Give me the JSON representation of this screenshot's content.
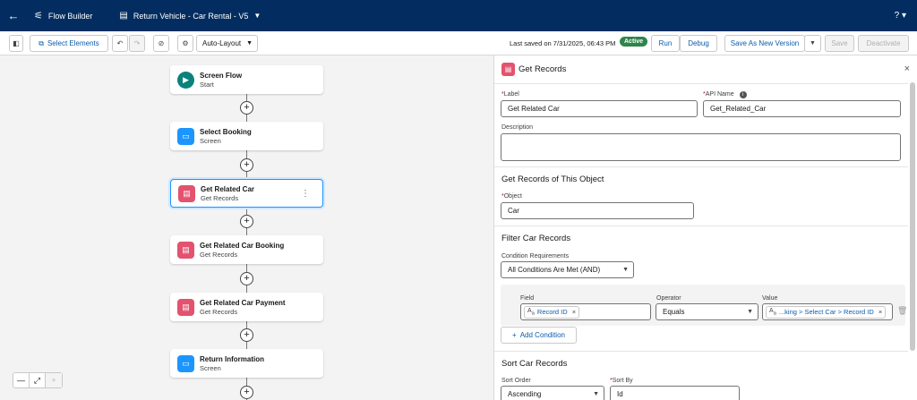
{
  "header": {
    "back_icon": "arrow-left-icon",
    "app_label": "Flow Builder",
    "doc_title": "Return Vehicle - Car Rental - V5",
    "help_label": "?"
  },
  "toolbar": {
    "select_elements": "Select Elements",
    "layout": "Auto-Layout",
    "last_saved": "Last saved on 7/31/2025, 06:43 PM",
    "status": "Active",
    "run": "Run",
    "debug": "Debug",
    "save_as": "Save As New Version",
    "save": "Save",
    "deactivate": "Deactivate"
  },
  "nodes": [
    {
      "title": "Screen Flow",
      "sub": "Start",
      "icon": "play-icon",
      "color": "#0b827c"
    },
    {
      "title": "Select Booking",
      "sub": "Screen",
      "icon": "screen-icon",
      "color": "#1b96ff"
    },
    {
      "title": "Get Related Car",
      "sub": "Get Records",
      "icon": "get-records-icon",
      "color": "#e3526e"
    },
    {
      "title": "Get Related Car Booking",
      "sub": "Get Records",
      "icon": "get-records-icon",
      "color": "#e3526e"
    },
    {
      "title": "Get Related Car Payment",
      "sub": "Get Records",
      "icon": "get-records-icon",
      "color": "#e3526e"
    },
    {
      "title": "Return Information",
      "sub": "Screen",
      "icon": "screen-icon",
      "color": "#1b96ff"
    }
  ],
  "panel": {
    "title": "Get Records",
    "label_label": "Label",
    "label_value": "Get Related Car",
    "api_label": "API Name",
    "api_value": "Get_Related_Car",
    "description_label": "Description",
    "description_value": "",
    "object_section": "Get Records of This Object",
    "object_label": "Object",
    "object_value": "Car",
    "filter_section": "Filter Car Records",
    "condition_label": "Condition Requirements",
    "condition_value": "All Conditions Are Met (AND)",
    "field_label": "Field",
    "field_value": "Record ID",
    "operator_label": "Operator",
    "operator_value": "Equals",
    "value_label": "Value",
    "value_value": "...king > Select Car > Record ID",
    "add_condition": "Add Condition",
    "sort_section": "Sort Car Records",
    "sort_order_label": "Sort Order",
    "sort_order_value": "Ascending",
    "sort_by_label": "Sort By",
    "sort_by_value": "Id"
  },
  "colors": {
    "header_bg": "#032d60",
    "active_badge": "#2e844a",
    "brand_blue": "#0b5cab",
    "get_records": "#e3526e"
  }
}
